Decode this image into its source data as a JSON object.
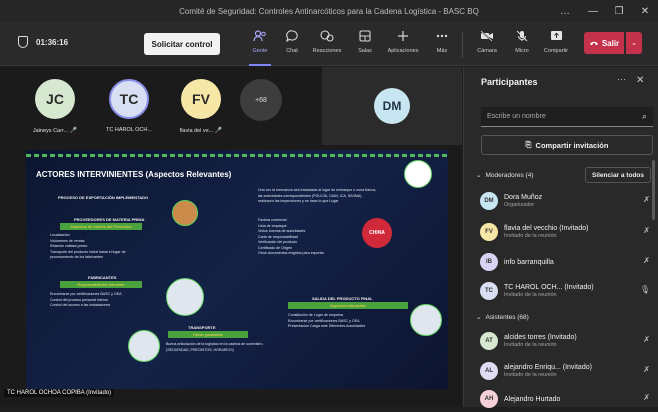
{
  "window": {
    "title": "Comité de Seguridad: Controles Antinarcóticos para la Cadena Logística - BASC BQ",
    "controls": [
      "…",
      "—",
      "❐",
      "✕"
    ]
  },
  "toolbar": {
    "timer": "01:36:16",
    "request_control": "Solicitar control",
    "tools": [
      {
        "label": "Gente",
        "icon": "people-icon"
      },
      {
        "label": "Chat",
        "icon": "chat-icon"
      },
      {
        "label": "Reacciones",
        "icon": "reactions-icon"
      },
      {
        "label": "Salas",
        "icon": "rooms-icon"
      },
      {
        "label": "Aplicaciones",
        "icon": "apps-icon"
      },
      {
        "label": "Más",
        "icon": "more-icon"
      },
      {
        "label": "Cámara",
        "icon": "camera-off-icon"
      },
      {
        "label": "Micro",
        "icon": "mic-off-icon"
      },
      {
        "label": "Compartir",
        "icon": "share-icon"
      }
    ],
    "leave": "Salir"
  },
  "stage": {
    "tiles": [
      {
        "initials": "JC",
        "name": "Jaineys Carr...",
        "color": "#d6e8d0"
      },
      {
        "initials": "TC",
        "name": "TC HAROL OCH...",
        "color": "#d9dff2"
      },
      {
        "initials": "FV",
        "name": "flavia del ve...",
        "color": "#f7e7a6"
      }
    ],
    "more_count": "+68",
    "dm_initials": "DM",
    "presenter_caption": "TC HAROL OCHOA COPIBA (Invitado)"
  },
  "slide": {
    "title": "ACTORES INTERVINIENTES (Aspectos Relevantes)",
    "section1": "PROCESO DE EXPORTACIÓN IMPLEMENTADO",
    "section1b": "PROVEEDORES DE MATERIA PRIMA",
    "bar1": "Aspectos de Interés del Proveedor",
    "list1": [
      "Localización",
      "Volúmenes de ventas",
      "Relación calidad-precio",
      "Transporte del producto inicial hasta el lugar de procesamiento de los fabricantes"
    ],
    "section2": "FABRICANTES",
    "bar2": "Responsabilidad relevante",
    "list2": [
      "Encontrarse por certificaciones BASC y OEA",
      "Control del proceso personal interno",
      "Control del acceso a las instalaciones"
    ],
    "section3": "TRANSPORTE",
    "bar3": "Deber garantizar",
    "list3": [
      "Buena articulación de la logística en la cadena de suministro. (SEGURIDAD, PRECINTOS, HORARIOS)"
    ],
    "right_text": "Una vez la mercancía sea trasladada al lugar de embarque o zona franca, las autoridades correspondientes (POLICÍA, DIAN, ICA, INVIMA) realizaron las inspecciones y se hace lo que Lugar",
    "right_list": [
      "Factura comercial",
      "Lista de empaque",
      "Vistos buenos de autoridades",
      "Carta de responsabilidad",
      "Verificación del producto",
      "Certificado de Origen",
      "Otros documentos exigidos para exportar"
    ],
    "china_label": "CHINA",
    "section4": "SALIDA DEL PRODUCTO FINAL",
    "bar4": "Aspectos relevantes",
    "list4": [
      "Constitución de Lugar de empresa",
      "Encontrarse por certificaciones BASC y OEA",
      "Presentación Carga ante Diferentes Autoridades"
    ]
  },
  "panel": {
    "title": "Participantes",
    "search_placeholder": "Escribe un nombre",
    "share_invite": "Compartir invitación",
    "moderators_label": "Moderadores (4)",
    "mute_all": "Silenciar a todos",
    "attendees_label": "Asistentes (68)",
    "moderators": [
      {
        "initials": "DM",
        "name": "Dora Muñoz",
        "role": "Organizador",
        "color": "#c7e6f2"
      },
      {
        "initials": "FV",
        "name": "flavia del vecchio (Invitado)",
        "role": "Invitado de la reunión",
        "color": "#f7e7a6"
      },
      {
        "initials": "IB",
        "name": "info barranquilla",
        "role": "",
        "color": "#d9d2f2"
      },
      {
        "initials": "TC",
        "name": "TC HAROL OCH...   (Invitado)",
        "role": "Invitado de la reunión",
        "color": "#d9dff2"
      }
    ],
    "attendees": [
      {
        "initials": "AT",
        "name": "alcides torres (Invitado)",
        "role": "Invitado de la reunión",
        "color": "#d6e8d0"
      },
      {
        "initials": "AL",
        "name": "alejandro Enriqu... (Invitado)",
        "role": "Invitado de la reunión",
        "color": "#e1dcf4"
      },
      {
        "initials": "AH",
        "name": "Alejandro Hurtado",
        "role": "",
        "color": "#f5d0d6"
      }
    ]
  }
}
